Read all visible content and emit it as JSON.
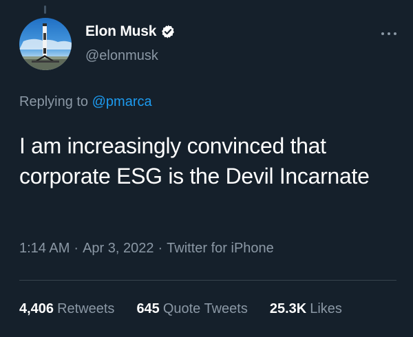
{
  "author": {
    "name": "Elon Musk",
    "handle": "@elonmusk",
    "verified": true
  },
  "reply": {
    "prefix": "Replying to",
    "mention": "@pmarca"
  },
  "tweet": {
    "text": "I am increasingly convinced that corporate ESG is the Devil Incarnate"
  },
  "meta": {
    "time": "1:14 AM",
    "separator": "·",
    "date": "Apr 3, 2022",
    "source": "Twitter for iPhone"
  },
  "stats": {
    "retweets": {
      "count": "4,406",
      "label": "Retweets"
    },
    "quote_tweets": {
      "count": "645",
      "label": "Quote Tweets"
    },
    "likes": {
      "count": "25.3K",
      "label": "Likes"
    }
  },
  "icons": {
    "verified": "verified-badge-icon",
    "more": "more-options-icon"
  },
  "colors": {
    "background": "#15202b",
    "text": "#ffffff",
    "secondary_text": "#8b98a5",
    "link": "#1d9bf0",
    "divider": "#38444d"
  }
}
